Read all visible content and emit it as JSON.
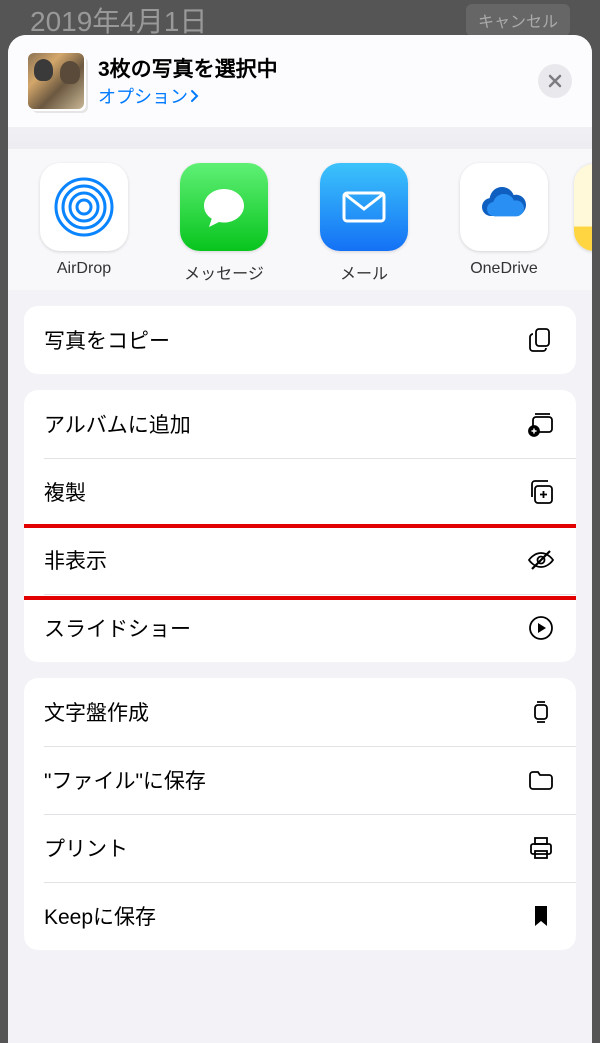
{
  "background": {
    "date": "2019年4月1日",
    "cancel": "キャンセル"
  },
  "sheet": {
    "title": "3枚の写真を選択中",
    "options_label": "オプション"
  },
  "apps": [
    {
      "id": "airdrop",
      "label": "AirDrop"
    },
    {
      "id": "messages",
      "label": "メッセージ"
    },
    {
      "id": "mail",
      "label": "メール"
    },
    {
      "id": "onedrive",
      "label": "OneDrive"
    },
    {
      "id": "notes",
      "label": ""
    }
  ],
  "groups": [
    {
      "items": [
        {
          "id": "copy",
          "label": "写真をコピー",
          "icon": "copy"
        }
      ]
    },
    {
      "items": [
        {
          "id": "addalbum",
          "label": "アルバムに追加",
          "icon": "album-add"
        },
        {
          "id": "duplicate",
          "label": "複製",
          "icon": "duplicate"
        },
        {
          "id": "hide",
          "label": "非表示",
          "icon": "eye-slash",
          "highlighted": true
        },
        {
          "id": "slideshow",
          "label": "スライドショー",
          "icon": "play"
        }
      ]
    },
    {
      "items": [
        {
          "id": "watchface",
          "label": "文字盤作成",
          "icon": "watch"
        },
        {
          "id": "savefiles",
          "label": "\"ファイル\"に保存",
          "icon": "folder"
        },
        {
          "id": "print",
          "label": "プリント",
          "icon": "print"
        },
        {
          "id": "keep",
          "label": "Keepに保存",
          "icon": "bookmark"
        }
      ]
    }
  ]
}
